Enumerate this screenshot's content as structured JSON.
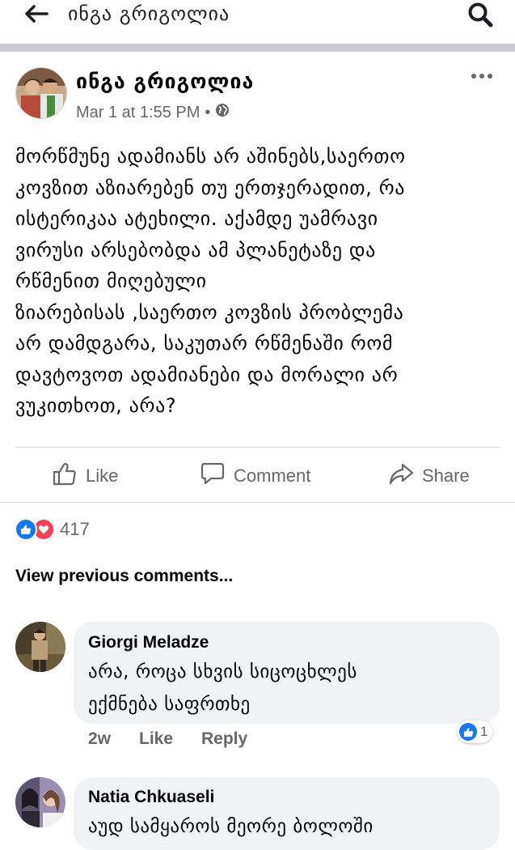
{
  "header": {
    "title": "ინგა გრიგოლია"
  },
  "post": {
    "author": "ინგა გრიგოლია",
    "timestamp": "Mar 1 at 1:55 PM",
    "separator": "•",
    "privacy_icon": "globe-icon",
    "text": "მორწმუნე ადამიანს არ აშინებს,საერთო\nკოვზით აზიარებენ თუ ერთჯერადით, რა\nისტერიკაა ატეხილი. აქამდე უამრავი\nვირუსი არსებობდა  ამ პლანეტაზე და\nრწმენით მიღებული\nზიარებისას ,საერთო კოვზის პრობლემა\nარ დამდგარა, საკუთარ რწმენაში რომ\nდავტოვოთ ადამიანები და მორალი  არ\nვუკითხოთ, არა?"
  },
  "actions": {
    "like": "Like",
    "comment": "Comment",
    "share": "Share"
  },
  "reactions": {
    "count": "417",
    "types": [
      "like",
      "love"
    ]
  },
  "view_previous": "View previous comments...",
  "comments": [
    {
      "name": "Giorgi Meladze",
      "text": "არა, როცა სხვის სიცოცხლეს\nექმნება საფრთხე",
      "time": "2w",
      "like": "Like",
      "reply": "Reply",
      "reaction_count": "1"
    },
    {
      "name": "Natia Chkuaseli",
      "text": "აუდ სამყაროს მეორე ბოლოში"
    }
  ],
  "colors": {
    "like_blue": "#1877f2",
    "love_red": "#f33e58",
    "secondary_text": "#65676b",
    "bubble_bg": "#f0f2f5",
    "divider_bar": "#c9ccd1"
  }
}
